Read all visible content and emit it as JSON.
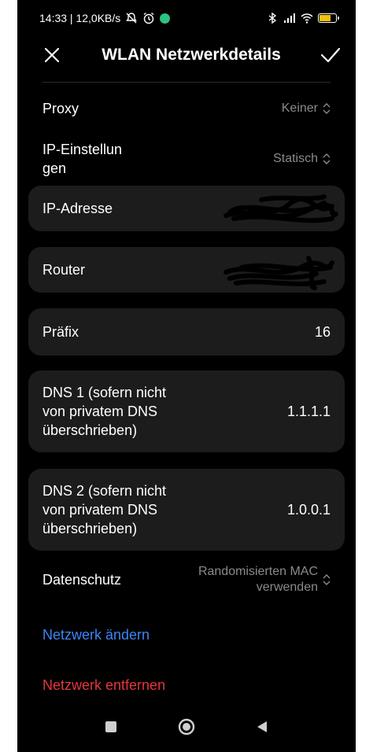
{
  "status_bar": {
    "time_speed": "14:33 | 12,0KB/s"
  },
  "header": {
    "title": "WLAN Netzwerkdetails"
  },
  "rows": {
    "proxy": {
      "label": "Proxy",
      "value": "Keiner"
    },
    "ip_settings": {
      "label_line1": "IP-Einstellun",
      "label_line2": "gen",
      "value": "Statisch"
    },
    "ip_address": {
      "label": "IP-Adresse"
    },
    "router": {
      "label": "Router"
    },
    "prefix": {
      "label": "Präfix",
      "value": "16"
    },
    "dns1": {
      "label_line1": "DNS 1 (sofern nicht",
      "label_line2": "von privatem DNS",
      "label_line3": "überschrieben)",
      "value": "1.1.1.1"
    },
    "dns2": {
      "label_line1": "DNS 2 (sofern nicht",
      "label_line2": "von privatem DNS",
      "label_line3": "überschrieben)",
      "value": "1.0.0.1"
    },
    "privacy": {
      "label": "Datenschutz",
      "value_line1": "Randomisierten MAC",
      "value_line2": "verwenden"
    }
  },
  "actions": {
    "modify": "Netzwerk ändern",
    "remove": "Netzwerk entfernen"
  },
  "colors": {
    "background": "#000000",
    "card": "#1c1c1c",
    "link_blue": "#3b86f7",
    "link_red": "#e5363b",
    "secondary_text": "#8a8a8a"
  },
  "icons": [
    "close-icon",
    "check-icon",
    "bluetooth-icon",
    "signal-icon",
    "wifi-icon",
    "battery-icon",
    "alarm-icon",
    "mute-icon",
    "updown-icon",
    "recent-apps-icon",
    "home-icon",
    "back-icon"
  ]
}
